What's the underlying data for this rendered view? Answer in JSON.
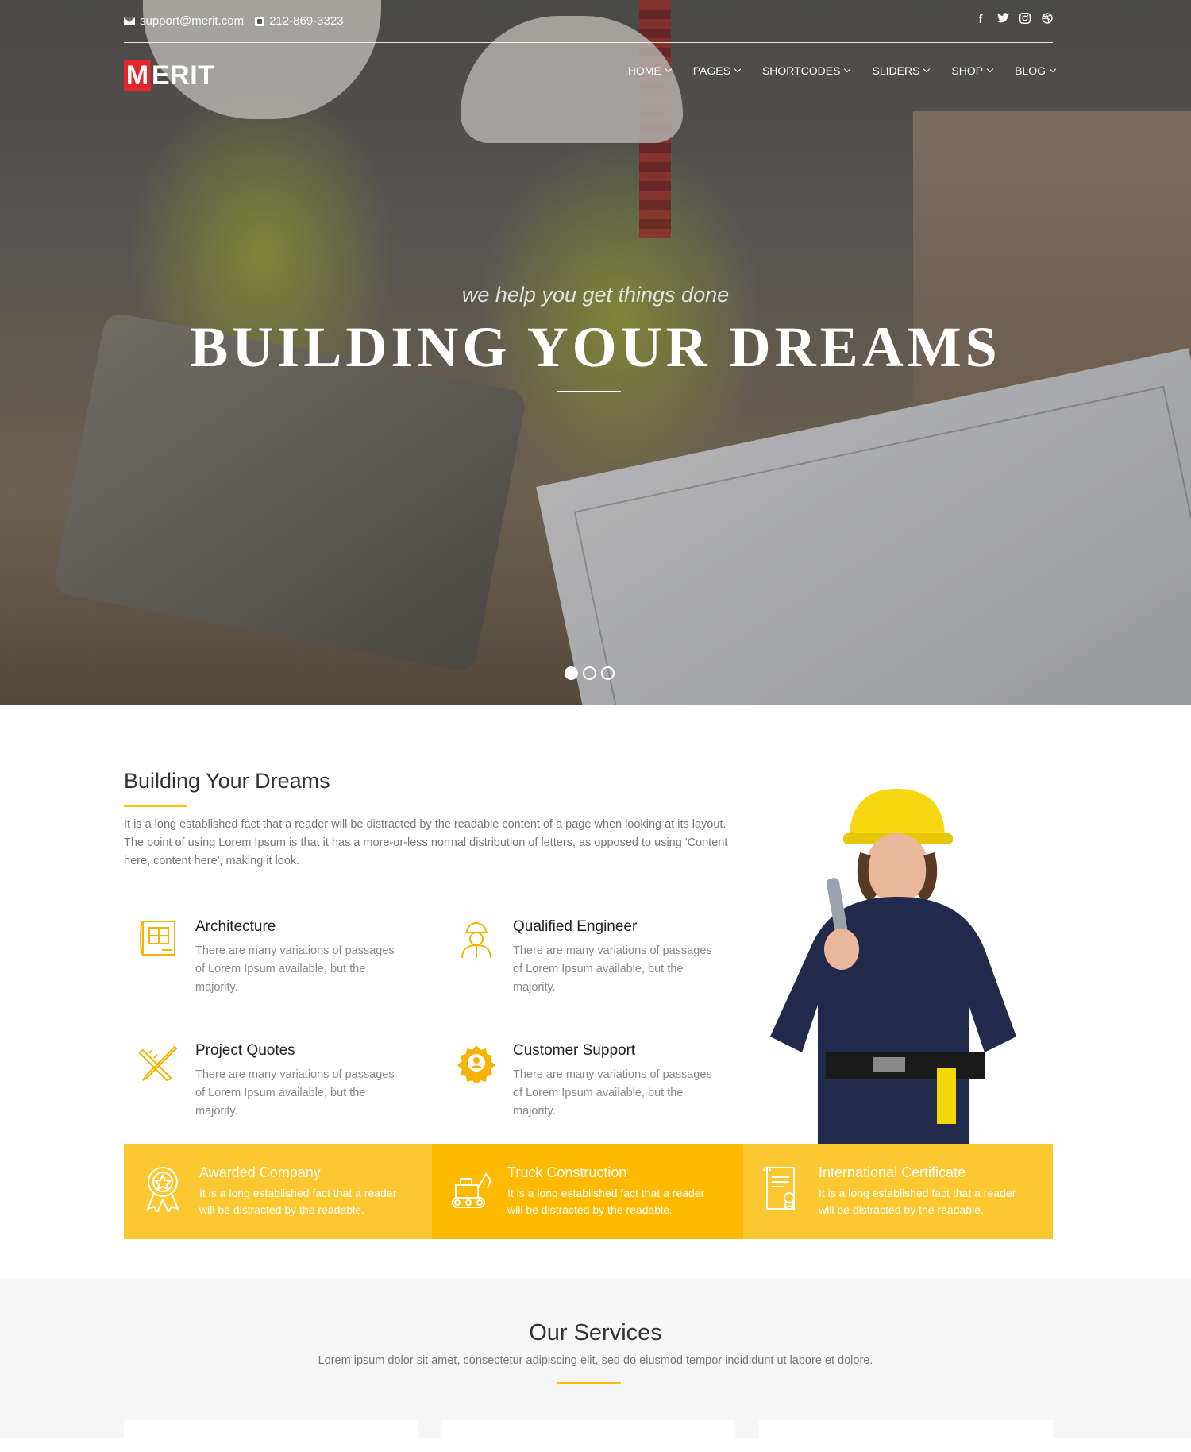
{
  "topbar": {
    "email": "support@merit.com",
    "phone": "212-869-3323",
    "social": [
      "f",
      "t",
      "ig",
      "db"
    ]
  },
  "logo": {
    "first_letter": "M",
    "rest": "ERIT"
  },
  "nav": {
    "items": [
      "HOME",
      "PAGES",
      "SHORTCODES",
      "SLIDERS",
      "SHOP",
      "BLOG"
    ]
  },
  "hero": {
    "tagline": "we help you get things done",
    "title": "BUILDING YOUR DREAMS",
    "slides": 3,
    "active_slide": 1
  },
  "about": {
    "title": "Building Your Dreams",
    "text": "It is a long established fact that a reader will be distracted by the readable content of a page when looking at its layout. The point of using Lorem Ipsum is that it has a more-or-less normal distribution of letters, as opposed to using 'Content here, content here', making it look.",
    "features": [
      {
        "icon": "blueprint-icon",
        "title": "Architecture",
        "desc": "There are many variations of passages of Lorem Ipsum available, but the majority."
      },
      {
        "icon": "engineer-icon",
        "title": "Qualified Engineer",
        "desc": "There are many variations of passages of Lorem Ipsum available, but the majority."
      },
      {
        "icon": "pencil-ruler-icon",
        "title": "Project Quotes",
        "desc": "There are many variations of passages of Lorem Ipsum available, but the majority."
      },
      {
        "icon": "gear-support-icon",
        "title": "Customer Support",
        "desc": "There are many variations of passages of Lorem Ipsum available, but the majority."
      }
    ]
  },
  "band": [
    {
      "icon": "award-icon",
      "title": "Awarded Company",
      "desc": "It is a long established fact that a reader will be distracted by the readable.",
      "color": "#fcc832"
    },
    {
      "icon": "excavator-icon",
      "title": "Truck Construction",
      "desc": "It is a long established fact that a reader will be distracted by the readable.",
      "color": "#fdba00"
    },
    {
      "icon": "certificate-icon",
      "title": "International Certificate",
      "desc": "It is a long established fact that a reader will be distracted by the readable.",
      "color": "#fcc832"
    }
  ],
  "services": {
    "title": "Our Services",
    "subtitle": "Lorem ipsum dolor sit amet, consectetur adipiscing elit, sed do eiusmod tempor incididunt ut labore et dolore."
  },
  "colors": {
    "accent": "#ffbf00",
    "brand_red": "#e2262f",
    "icon_yellow": "#f5b400"
  }
}
